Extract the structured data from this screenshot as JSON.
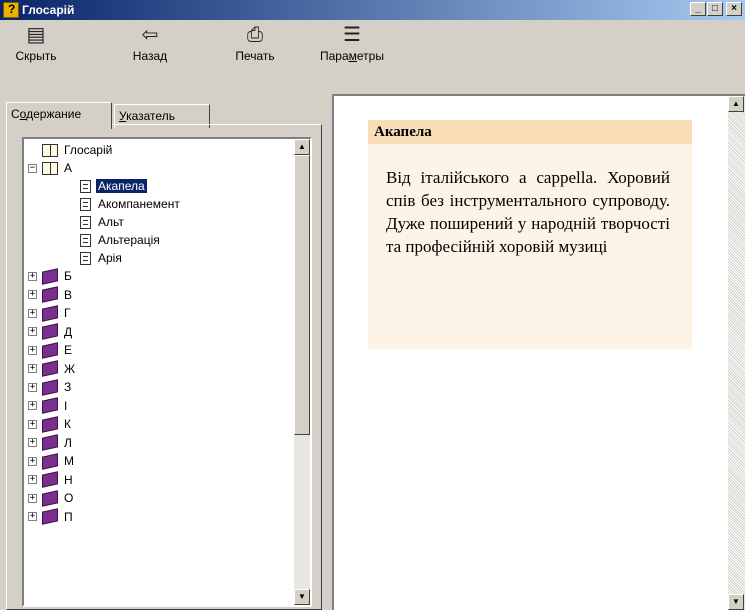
{
  "window": {
    "title": "Глосарій",
    "buttons": {
      "minimize": "_",
      "maximize": "□",
      "close": "×"
    }
  },
  "toolbar": {
    "hide": {
      "label": "Скрыть",
      "icon": "hide-pane-icon"
    },
    "back": {
      "label": "Назад",
      "icon": "back-arrow-icon"
    },
    "print": {
      "label": "Печать",
      "icon": "printer-icon"
    },
    "options": {
      "label_pre": "Пара",
      "label_mnemonic": "м",
      "label_post": "етры",
      "icon": "options-icon"
    }
  },
  "tabs": {
    "contents": {
      "pre": "С",
      "mnemonic": "о",
      "post": "держание"
    },
    "index": {
      "pre": "",
      "mnemonic": "У",
      "post": "казатель"
    }
  },
  "tree": {
    "root": "Глосарій",
    "open_book": "А",
    "pages": [
      "Акапела",
      "Акомпанемент",
      "Альт",
      "Альтерація",
      "Арія"
    ],
    "selected_page": "Акапела",
    "books": [
      "Б",
      "В",
      "Г",
      "Д",
      "Е",
      "Ж",
      "З",
      "І",
      "К",
      "Л",
      "М",
      "Н",
      "О",
      "П"
    ]
  },
  "topic": {
    "title": "Акапела",
    "body": "Від італійського a cappella. Хоровий спів без інструментального супроводу. Дуже поширений у народній творчості та професійній хоровій музиці"
  },
  "colors": {
    "titlebar_start": "#0a246a",
    "titlebar_end": "#a6caf0",
    "header_bg": "#f9ddb6",
    "body_bg": "#fdf3e6",
    "book_closed": "#7a2f8f",
    "selection": "#0a246a"
  }
}
